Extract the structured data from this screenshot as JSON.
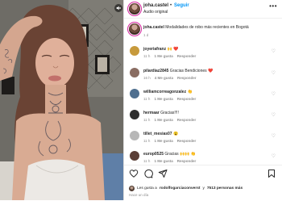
{
  "post": {
    "username": "joha.castel",
    "follow_label": "Seguir",
    "audio_label": "Audio original",
    "more_label": "•••",
    "caption_text": "Modalidades de robo más recientes en Bogotá",
    "caption_time": "1 d"
  },
  "comments": [
    {
      "user": "joyeriafranz",
      "text": "🙌 ❤️",
      "time": "11 h",
      "likes": "1 Me gusta",
      "reply": "Responder",
      "avatar_color": "#c79a3c"
    },
    {
      "user": "pilardiaz2845",
      "text": "Gracias Bendiciones ❤️",
      "time": "16 h",
      "likes": "4 Me gusta",
      "reply": "Responder",
      "avatar_color": "#8a6d62"
    },
    {
      "user": "williamcorreagonzalez",
      "text": "👏",
      "time": "11 h",
      "likes": "1 Me gusta",
      "reply": "Responder",
      "avatar_color": "#4f6f8f"
    },
    {
      "user": "hermaar",
      "text": "Gracias!!!!",
      "time": "11 h",
      "likes": "1 Me gusta",
      "reply": "Responder",
      "avatar_color": "#2f2f2f"
    },
    {
      "user": "tillet_mesias07",
      "text": "😮",
      "time": "11 h",
      "likes": "1 Me gusta",
      "reply": "Responder",
      "avatar_color": "#b7b7b7"
    },
    {
      "user": "europ0525",
      "text": "Gracias 🙌🙌 👏",
      "time": "11 h",
      "likes": "1 Me gusta",
      "reply": "Responder",
      "avatar_color": "#5a3e36"
    }
  ],
  "footer": {
    "likes_prefix": "Les gusta a",
    "liked_by": "rodolfogarciaconverst",
    "likes_suffix": "y",
    "likes_count": "7513 personas más",
    "date": "Hace un día"
  },
  "colors": {
    "accent": "#0095f6",
    "like_red": "#ed4956",
    "muted": "#8e8e8e"
  },
  "icons": [
    "heart-icon",
    "comment-icon",
    "share-icon",
    "bookmark-icon",
    "sound-off-icon",
    "more-icon"
  ]
}
